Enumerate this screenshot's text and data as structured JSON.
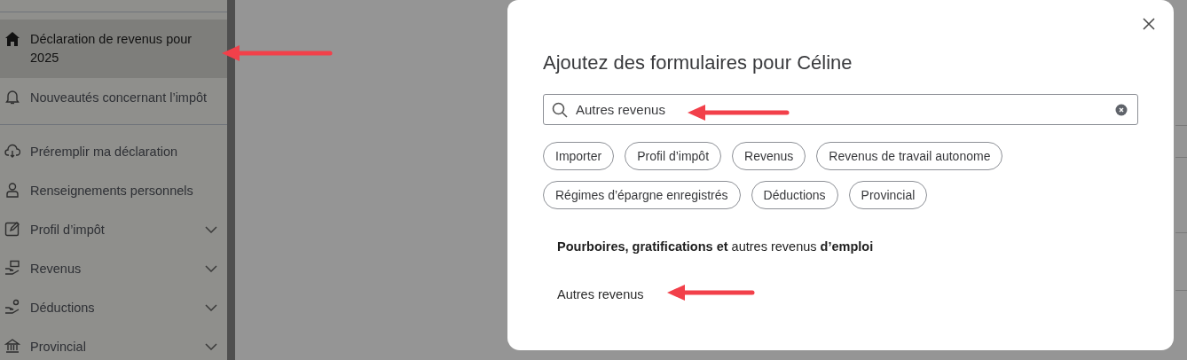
{
  "sidebar": {
    "items": [
      {
        "label": "Déclaration de revenus pour 2025",
        "selected": true,
        "expandable": false
      },
      {
        "label": "Nouveautés concernant l’impôt",
        "selected": false,
        "expandable": false
      },
      {
        "label": "Préremplir ma déclaration",
        "selected": false,
        "expandable": false
      },
      {
        "label": "Renseignements personnels",
        "selected": false,
        "expandable": false
      },
      {
        "label": "Profil d’impôt",
        "selected": false,
        "expandable": true
      },
      {
        "label": "Revenus",
        "selected": false,
        "expandable": true
      },
      {
        "label": "Déductions",
        "selected": false,
        "expandable": true
      },
      {
        "label": "Provincial",
        "selected": false,
        "expandable": true
      }
    ]
  },
  "dialog": {
    "title": "Ajoutez des formulaires pour Céline",
    "search": {
      "value": "Autres revenus"
    },
    "filters": [
      "Importer",
      "Profil d’impôt",
      "Revenus",
      "Revenus de travail autonome",
      "Régimes d’épargne enregistrés",
      "Déductions",
      "Provincial"
    ],
    "results": [
      {
        "kind": "heading",
        "text": "**Pourboires, gratifications et** autres revenus **d’emploi**"
      },
      {
        "kind": "link",
        "text": "Autres revenus"
      }
    ]
  }
}
